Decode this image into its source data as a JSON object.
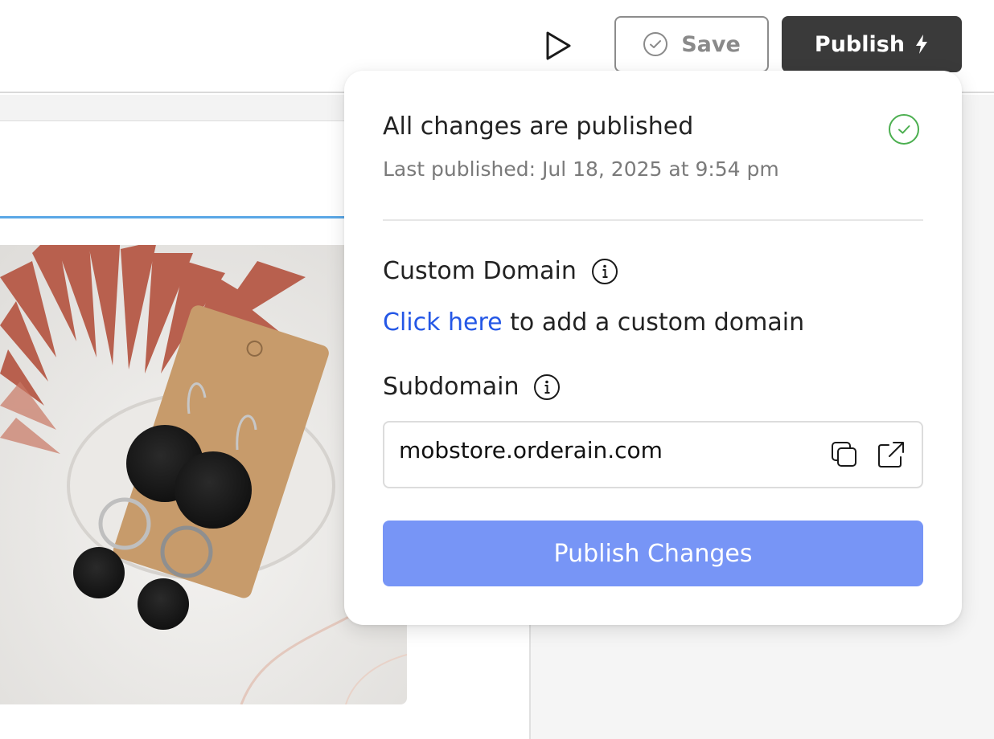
{
  "toolbar": {
    "preview_icon": "play-icon",
    "save_label": "Save",
    "save_icon": "check-circle-icon",
    "publish_label": "Publish",
    "publish_icon": "lightning-icon"
  },
  "publish_popover": {
    "status_title": "All changes are published",
    "status_icon": "check-circle-icon",
    "last_published": "Last published: Jul 18, 2025 at 9:54 pm",
    "custom_domain": {
      "heading": "Custom Domain",
      "info_icon": "info-icon",
      "link_text": "Click here",
      "suffix_text": " to add a custom domain"
    },
    "subdomain": {
      "heading": "Subdomain",
      "info_icon": "info-icon",
      "value": "mobstore.orderain.com",
      "copy_icon": "copy-icon",
      "open_icon": "external-link-icon"
    },
    "publish_changes_label": "Publish Changes"
  },
  "colors": {
    "publish_button_bg": "#3a3a3a",
    "link": "#2457e6",
    "publish_changes_bg": "#7795f6",
    "success": "#4caf50"
  }
}
